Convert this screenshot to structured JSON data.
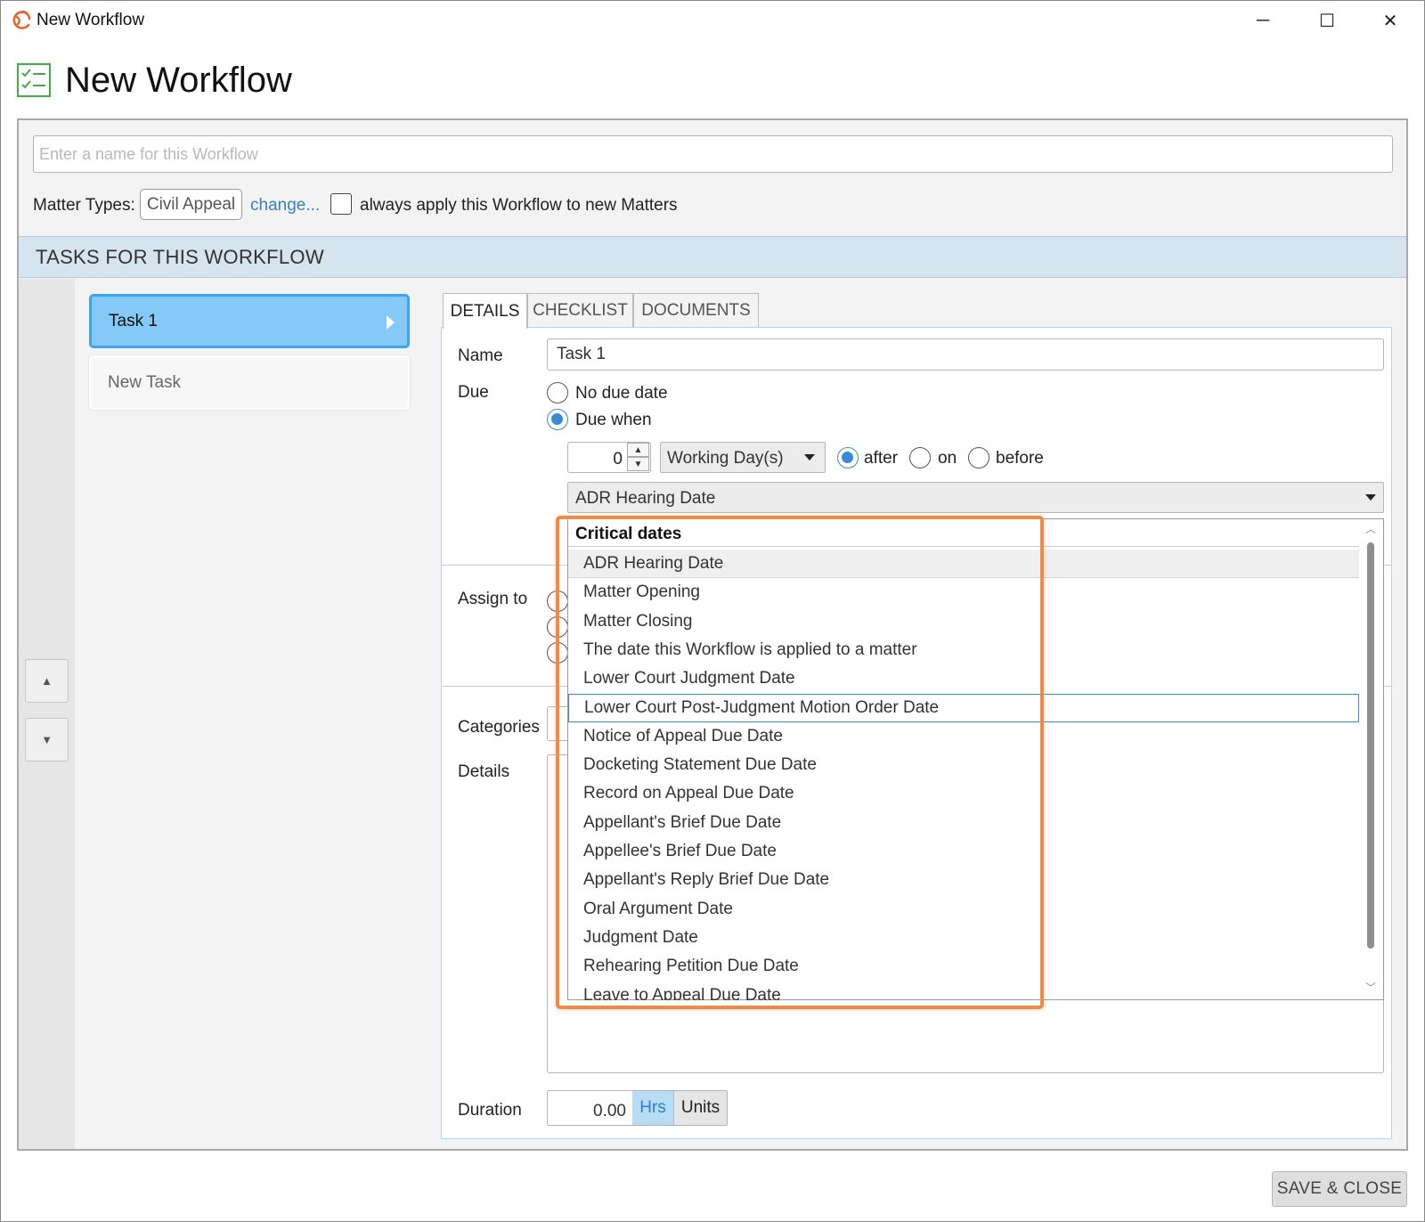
{
  "window": {
    "title": "New Workflow",
    "controls": {
      "minimize": "─",
      "maximize": "☐",
      "close": "✕"
    }
  },
  "header": {
    "title": "New Workflow",
    "icon": "checklist-icon"
  },
  "workflow": {
    "name_placeholder": "Enter a name for this Workflow",
    "name_value": "",
    "matter_types_label": "Matter Types:",
    "matter_type": "Civil Appeal",
    "change_link": "change...",
    "always_apply_label": "always apply this Workflow to new Matters",
    "always_apply_checked": false
  },
  "tasks_section": {
    "title": "TASKS FOR THIS WORKFLOW",
    "tasks": [
      {
        "label": "Task 1",
        "selected": true
      },
      {
        "label": "New Task",
        "selected": false
      }
    ],
    "move_up": "▲",
    "move_down": "▼"
  },
  "detail": {
    "tabs": [
      "DETAILS",
      "CHECKLIST",
      "DOCUMENTS"
    ],
    "active_tab": "DETAILS",
    "name_label": "Name",
    "name_value": "Task 1",
    "due_label": "Due",
    "due_options": [
      "No due date",
      "Due when"
    ],
    "due_selected": "Due when",
    "offset_value": "0",
    "unit": "Working Day(s)",
    "relation_options": [
      "after",
      "on",
      "before"
    ],
    "relation_selected": "after",
    "anchor_date": "ADR Hearing Date",
    "assign_label": "Assign to",
    "categories_label": "Categories",
    "details_label": "Details",
    "duration_label": "Duration",
    "duration_value": "0.00",
    "duration_hrs": "Hrs",
    "duration_units": "Units"
  },
  "dropdown": {
    "group_header": "Critical dates",
    "items": [
      "ADR Hearing Date",
      "Matter Opening",
      "Matter Closing",
      "The date this Workflow is applied to a matter",
      "Lower Court Judgment Date",
      "Lower Court Post-Judgment Motion Order Date",
      "Notice of Appeal Due Date",
      "Docketing Statement Due Date",
      "Record on Appeal Due Date",
      "Appellant's Brief Due Date",
      "Appellee's Brief Due Date",
      "Appellant's Reply Brief Due Date",
      "Oral Argument Date",
      "Judgment Date",
      "Rehearing Petition Due Date",
      "Leave to Appeal Due Date"
    ],
    "hovered_item": "ADR Hearing Date",
    "focused_item": "Lower Court Post-Judgment Motion Order Date",
    "highlight_color": "#f08a45"
  },
  "footer": {
    "save_close": "SAVE & CLOSE"
  },
  "colors": {
    "accent": "#3a8ad6",
    "selected_task": "#84c9f7",
    "header_band": "#d6e4ef"
  }
}
